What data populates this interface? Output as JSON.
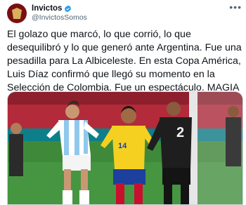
{
  "tweet": {
    "display_name": "Invictos",
    "handle": "@InvictosSomos",
    "verified_icon": "verified-badge-icon",
    "more_icon": "more-horizontal-icon",
    "text": "El golazo que marcó, lo que corrió, lo que desequilibró y lo que generó ante Argentina. Fue una pesadilla para La Albiceleste. En esta Copa América, Luis Díaz confirmó que llegó su momento en la Selección de Colombia. Fue un espectáculo. MAGIA COLOMBIANA."
  },
  "media": {
    "jersey_numbers": [
      "14",
      "2"
    ],
    "colors": {
      "colombia_jersey": "#f5d020",
      "colombia_shorts": "#1d3f9e",
      "argentina_stripe": "#8fc8ec",
      "referee": "#1e1e1e",
      "pitch": "#3f8a3a",
      "stands": "#b32a3a"
    }
  }
}
